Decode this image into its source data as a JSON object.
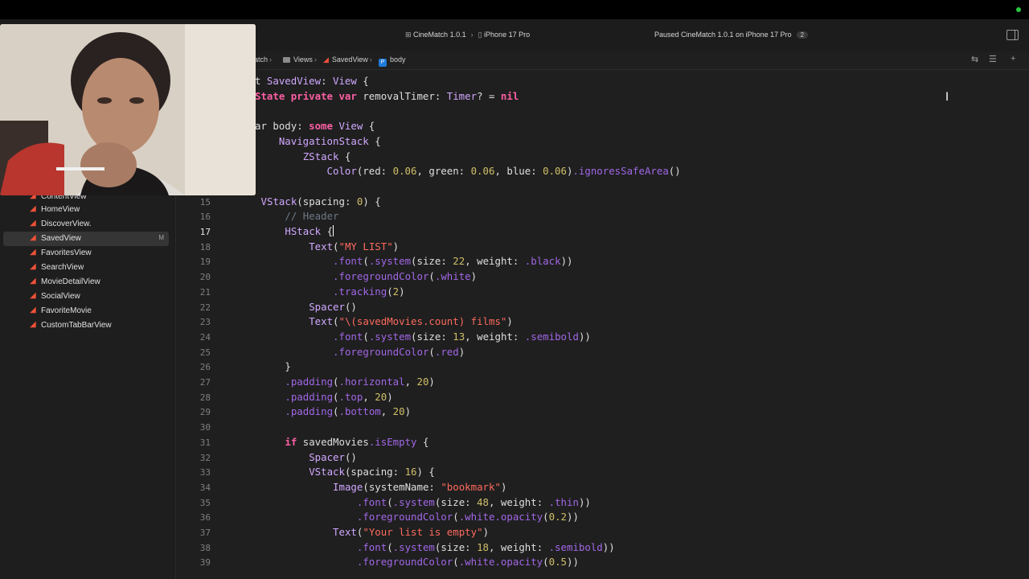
{
  "toolbar": {
    "scheme": "CineMatch 1.0.1",
    "destination": "iPhone 17 Pro",
    "status": "Paused CineMatch 1.0.1 on iPhone 17 Pro",
    "status_count": "2"
  },
  "jumpbar": {
    "project": "atch",
    "folder": "Views",
    "file": "SavedView",
    "symbol": "body"
  },
  "sidebar": {
    "items": [
      {
        "label": "ContentView"
      },
      {
        "label": "HomeView"
      },
      {
        "label": "DiscoverView."
      },
      {
        "label": "SavedView",
        "badge": "M"
      },
      {
        "label": "FavoritesView"
      },
      {
        "label": "SearchView"
      },
      {
        "label": "MovieDetailView"
      },
      {
        "label": "SocialView"
      },
      {
        "label": "FavoriteMovie"
      },
      {
        "label": "CustomTabBarView"
      }
    ]
  },
  "editor": {
    "current_line": 17,
    "lines": [
      {
        "num": "",
        "text": "t SavedView: View {"
      },
      {
        "num": "",
        "text": "State private var removalTimer: Timer? = nil"
      },
      {
        "num": "",
        "text": ""
      },
      {
        "num": "",
        "text": "ar body: some View {"
      },
      {
        "num": "",
        "text": "    NavigationStack {"
      },
      {
        "num": "",
        "text": "        ZStack {"
      },
      {
        "num": "",
        "text": "            Color(red: 0.06, green: 0.06, blue: 0.06).ignoresSafeArea()"
      },
      {
        "num": "",
        "text": ""
      },
      {
        "num": "15",
        "text": "            VStack(spacing: 0) {"
      },
      {
        "num": "16",
        "text": "                // Header"
      },
      {
        "num": "17",
        "text": "                HStack {"
      },
      {
        "num": "18",
        "text": "                    Text(\"MY LIST\")"
      },
      {
        "num": "19",
        "text": "                        .font(.system(size: 22, weight: .black))"
      },
      {
        "num": "20",
        "text": "                        .foregroundColor(.white)"
      },
      {
        "num": "21",
        "text": "                        .tracking(2)"
      },
      {
        "num": "22",
        "text": "                    Spacer()"
      },
      {
        "num": "23",
        "text": "                    Text(\"\\(savedMovies.count) films\")"
      },
      {
        "num": "24",
        "text": "                        .font(.system(size: 13, weight: .semibold))"
      },
      {
        "num": "25",
        "text": "                        .foregroundColor(.red)"
      },
      {
        "num": "26",
        "text": "                }"
      },
      {
        "num": "27",
        "text": "                .padding(.horizontal, 20)"
      },
      {
        "num": "28",
        "text": "                .padding(.top, 20)"
      },
      {
        "num": "29",
        "text": "                .padding(.bottom, 20)"
      },
      {
        "num": "30",
        "text": ""
      },
      {
        "num": "31",
        "text": "                if savedMovies.isEmpty {"
      },
      {
        "num": "32",
        "text": "                    Spacer()"
      },
      {
        "num": "33",
        "text": "                    VStack(spacing: 16) {"
      },
      {
        "num": "34",
        "text": "                        Image(systemName: \"bookmark\")"
      },
      {
        "num": "35",
        "text": "                            .font(.system(size: 48, weight: .thin))"
      },
      {
        "num": "36",
        "text": "                            .foregroundColor(.white.opacity(0.2))"
      },
      {
        "num": "37",
        "text": "                        Text(\"Your list is empty\")"
      },
      {
        "num": "38",
        "text": "                            .font(.system(size: 18, weight: .semibold))"
      },
      {
        "num": "39",
        "text": "                            .foregroundColor(.white.opacity(0.5))"
      }
    ]
  },
  "colors": {
    "keyword": "#fc5fa3",
    "type": "#d0a8ff",
    "function": "#a167e6",
    "string": "#fc6a5d",
    "number": "#d0bf69",
    "comment": "#6c7986"
  }
}
